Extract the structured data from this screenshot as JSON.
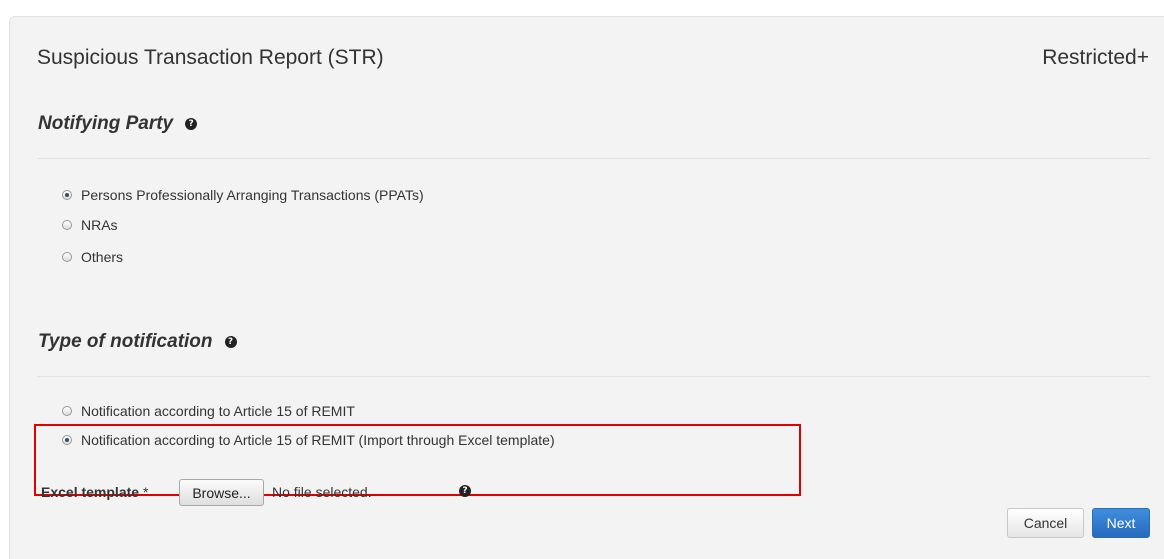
{
  "header": {
    "title": "Suspicious Transaction Report (STR)",
    "classification": "Restricted+"
  },
  "notifying_party": {
    "title": "Notifying Party",
    "help_icon": "question-circle-icon",
    "options": [
      {
        "label": "Persons Professionally Arranging Transactions (PPATs)",
        "checked": true
      },
      {
        "label": "NRAs",
        "checked": false
      },
      {
        "label": "Others",
        "checked": false
      }
    ]
  },
  "notification_type": {
    "title": "Type of notification",
    "help_icon": "question-circle-icon",
    "options": [
      {
        "label": "Notification according to Article 15 of REMIT",
        "checked": false
      },
      {
        "label": "Notification according to Article 15 of REMIT (Import through Excel template)",
        "checked": true
      }
    ]
  },
  "excel_upload": {
    "label": "Excel template",
    "required_marker": "*",
    "browse_label": "Browse...",
    "file_status": "No file selected.",
    "help_icon": "question-circle-icon"
  },
  "actions": {
    "cancel_label": "Cancel",
    "next_label": "Next"
  },
  "colors": {
    "panel_background": "#f3f3f3",
    "highlight_border": "#e00000",
    "primary_button": "#2f7bd0"
  }
}
